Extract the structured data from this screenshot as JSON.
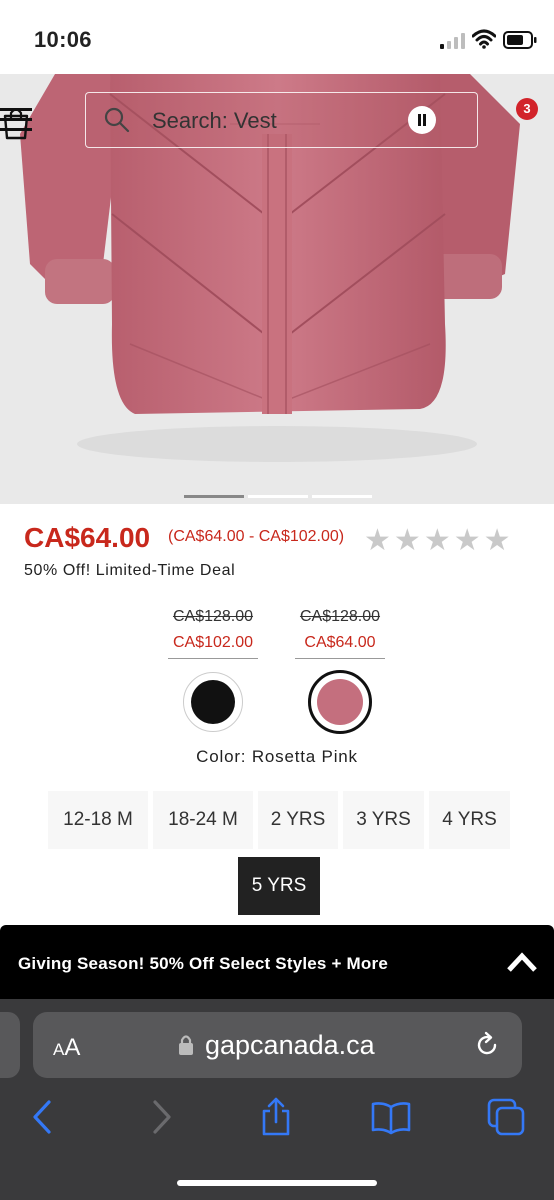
{
  "status_bar": {
    "time": "10:06"
  },
  "header": {
    "search_placeholder": "Search: Vest",
    "cart_count": "3"
  },
  "product": {
    "price": "CA$64.00",
    "price_range": "(CA$64.00 - CA$102.00)",
    "rating": {
      "max": 5,
      "filled": 0
    },
    "deal": "50% Off! Limited-Time Deal",
    "swatches": [
      {
        "name": "black",
        "old_price": "CA$128.00",
        "new_price": "CA$102.00",
        "color": "#111111",
        "selected": false
      },
      {
        "name": "rosetta-pink",
        "old_price": "CA$128.00",
        "new_price": "CA$64.00",
        "color": "#c46f7e",
        "selected": true
      }
    ],
    "color_label": "Color: Rosetta Pink",
    "sizes": [
      {
        "label": "12-18 M",
        "selected": false
      },
      {
        "label": "18-24 M",
        "selected": false
      },
      {
        "label": "2 YRS",
        "selected": false
      },
      {
        "label": "3 YRS",
        "selected": false
      },
      {
        "label": "4 YRS",
        "selected": false
      },
      {
        "label": "5 YRS",
        "selected": true
      }
    ]
  },
  "promo": {
    "text": "Giving Season! 50% Off Select Styles + More"
  },
  "browser": {
    "aa_small": "A",
    "aa_large": "A",
    "url": "gapcanada.ca"
  },
  "colors": {
    "sale_red": "#c8281c",
    "badge_red": "#d2232a",
    "ios_blue": "#3478f6",
    "jacket_pink": "#c46f7e"
  }
}
